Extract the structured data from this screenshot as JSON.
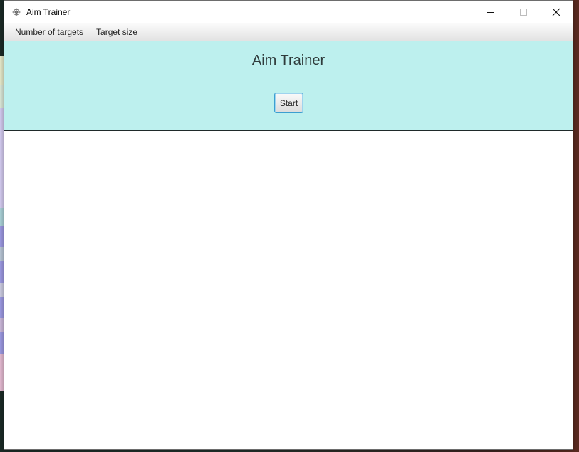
{
  "window": {
    "title": "Aim Trainer",
    "icon": "crosshair-icon",
    "controls": [
      "minimize-icon",
      "maximize-icon",
      "close-icon"
    ]
  },
  "menubar": {
    "items": [
      {
        "label": "Number of targets"
      },
      {
        "label": "Target size"
      }
    ]
  },
  "header": {
    "title": "Aim Trainer",
    "start_label": "Start",
    "background": "#bdf0ee"
  },
  "colors": {
    "accent": "#3c9fd1",
    "panel": "#bdf0ee"
  }
}
